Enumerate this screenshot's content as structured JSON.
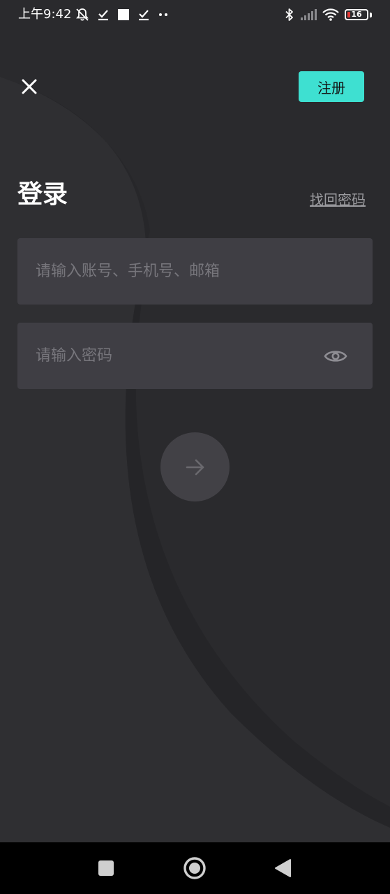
{
  "status_bar": {
    "time": "上午9:42",
    "battery_level": 16,
    "battery_text": "16",
    "icons": [
      "mute-bell-icon",
      "check-icon",
      "square-icon",
      "check-icon",
      "more-dots-icon",
      "bluetooth-icon",
      "signal-icon",
      "wifi-icon",
      "battery-icon"
    ]
  },
  "header": {
    "close_icon": "close-icon",
    "register_label": "注册"
  },
  "login": {
    "title": "登录",
    "forgot_password": "找回密码",
    "account_placeholder": "请输入账号、手机号、邮箱",
    "account_value": "",
    "password_placeholder": "请输入密码",
    "password_value": "",
    "password_toggle_icon": "eye-icon",
    "submit_icon": "arrow-right-icon"
  },
  "nav_bar": {
    "icons": [
      "recents-square-icon",
      "home-circle-icon",
      "back-triangle-icon"
    ]
  },
  "colors": {
    "background": "#2a2a2d",
    "accent": "#3ee0d1",
    "input_bg": "#3f3e44",
    "placeholder": "#77767c",
    "battery_low": "#e53935"
  }
}
